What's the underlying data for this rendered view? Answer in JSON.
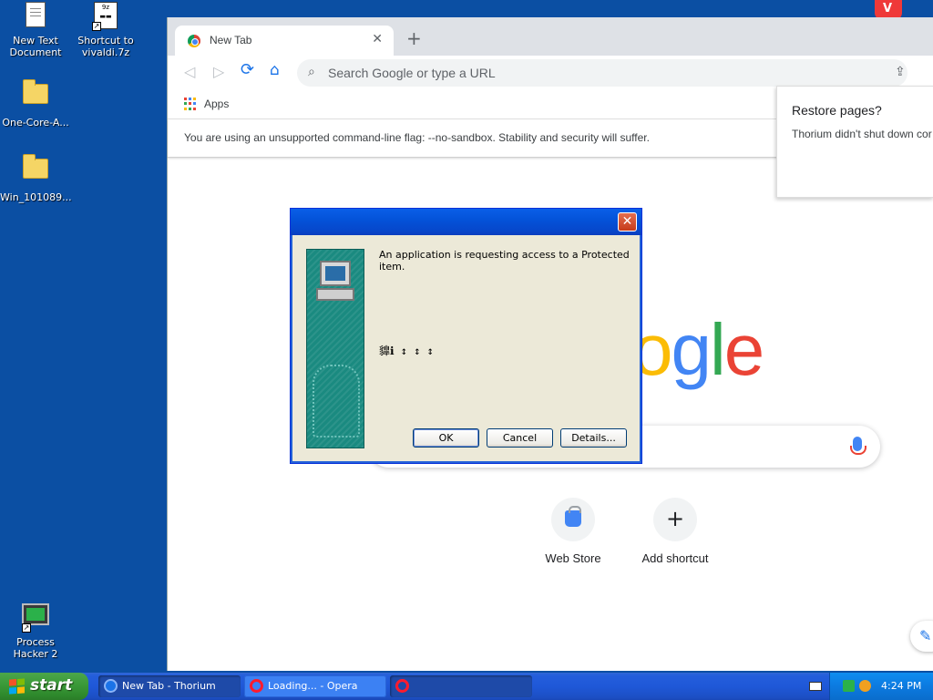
{
  "desktop": {
    "icons": [
      {
        "label": "New Text Document",
        "icon": "text-document-icon"
      },
      {
        "label": "Shortcut to vivaldi.7z",
        "icon": "archive-shortcut-icon"
      },
      {
        "label": "One-Core-A...",
        "icon": "folder-icon"
      },
      {
        "label": "Win_101089...",
        "icon": "folder-icon"
      },
      {
        "label": "Process Hacker 2",
        "icon": "process-hacker-icon"
      }
    ]
  },
  "browser": {
    "tab_title": "New Tab",
    "tab_close": "✕",
    "new_tab": "+",
    "omnibox_placeholder": "Search Google or type a URL",
    "bookmarks_apps": "Apps",
    "infobar_text": "You are using an unsupported command-line flag: --no-sandbox. Stability and security will suffer.",
    "restore": {
      "title": "Restore pages?",
      "body": "Thorium didn't shut down cor"
    },
    "logo_visible": "ogle",
    "shortcuts": [
      {
        "label": "Web Store",
        "icon": "web-store-icon"
      },
      {
        "label": "Add shortcut",
        "icon": "plus-icon",
        "glyph": "+"
      }
    ],
    "colors": {
      "blue": "#4285f4",
      "red": "#ea4335",
      "yellow": "#fbbc05",
      "green": "#34a853"
    }
  },
  "dialog": {
    "message": "An application is requesting access to a Protected item.",
    "garbled_text": "䝥ℹ ↕ ↕ ↕",
    "close_glyph": "✕",
    "buttons": {
      "ok": "OK",
      "cancel": "Cancel",
      "details": "Details..."
    }
  },
  "taskbar": {
    "start_label": "start",
    "items": [
      {
        "label": "New Tab - Thorium",
        "state": "active"
      },
      {
        "label": "Loading... - Opera",
        "state": "normal"
      },
      {
        "label": "",
        "state": "active"
      }
    ],
    "clock": "4:24 PM"
  }
}
